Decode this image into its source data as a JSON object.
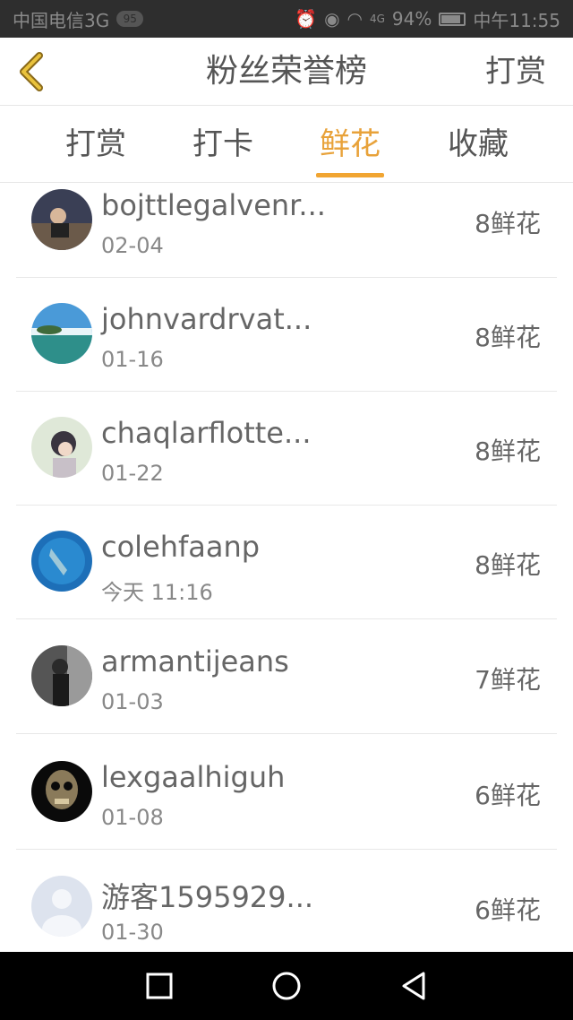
{
  "status_bar": {
    "carrier": "中国电信3G",
    "badge": "95",
    "signal": "4G",
    "battery": "94%",
    "time": "中午11:55"
  },
  "header": {
    "title": "粉丝荣誉榜",
    "action": "打赏"
  },
  "tabs": [
    {
      "label": "打赏"
    },
    {
      "label": "打卡"
    },
    {
      "label": "鲜花",
      "selected": true
    },
    {
      "label": "收藏"
    }
  ],
  "accent_color": "#f1a532",
  "rows": [
    {
      "name": "bojttlegalvenr...",
      "date": "02-04",
      "amount": "8鲜花"
    },
    {
      "name": "johnvardrvat...",
      "date": "01-16",
      "amount": "8鲜花"
    },
    {
      "name": "chaqlarflotte...",
      "date": "01-22",
      "amount": "8鲜花"
    },
    {
      "name": "colehfaanp",
      "date": "今天 11:16",
      "amount": "8鲜花"
    },
    {
      "name": "armantijeans",
      "date": "01-03",
      "amount": "7鲜花"
    },
    {
      "name": "lexgaalhiguh",
      "date": "01-08",
      "amount": "6鲜花"
    },
    {
      "name": "游客1595929...",
      "date": "01-30",
      "amount": "6鲜花"
    }
  ]
}
